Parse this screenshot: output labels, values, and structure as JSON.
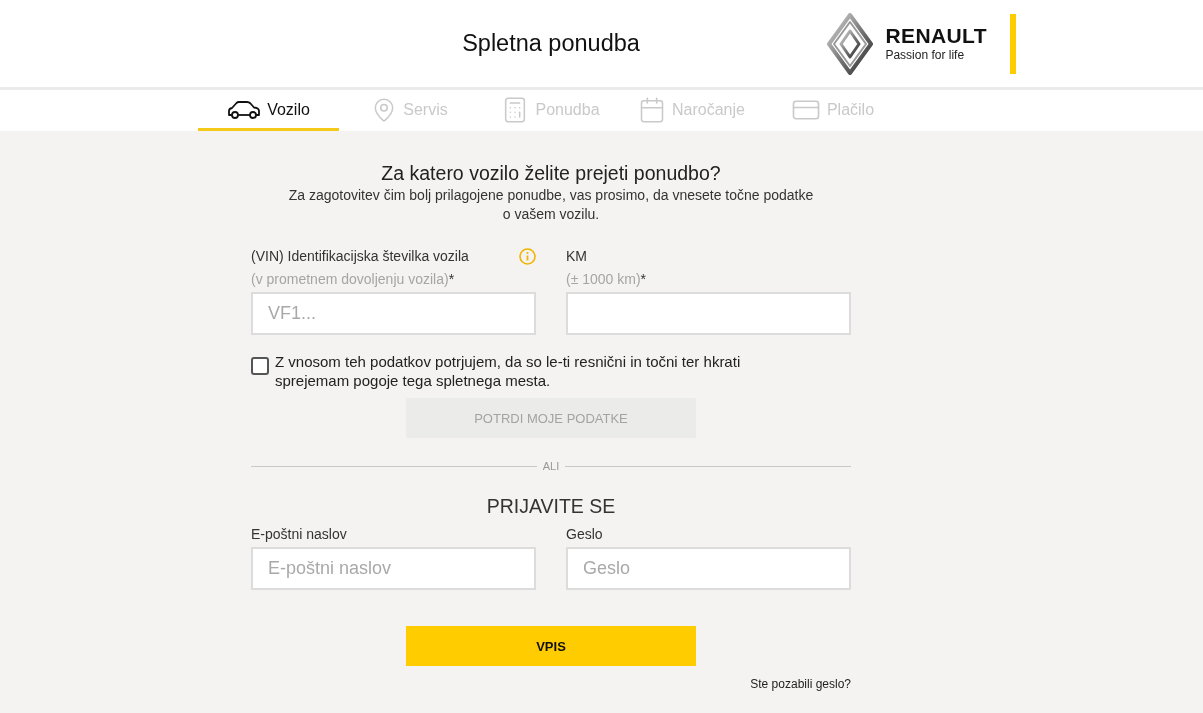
{
  "header": {
    "title": "Spletna ponudba",
    "brand_name": "RENAULT",
    "tagline": "Passion for life"
  },
  "steps": [
    {
      "kind": "car",
      "label": "Vozilo",
      "selected": true
    },
    {
      "kind": "pin",
      "label": "Servis",
      "selected": false
    },
    {
      "kind": "calculator",
      "label": "Ponudba",
      "selected": false
    },
    {
      "kind": "calendar",
      "label": "Naročanje",
      "selected": false
    },
    {
      "kind": "card",
      "label": "Plačilo",
      "selected": false
    }
  ],
  "vehicle_form": {
    "heading": "Za katero vozilo želite prejeti ponudbo?",
    "intro": "Za zagotovitev čim bolj prilagojene ponudbe, vas prosimo, da vnesete točne podatke o vašem vozilu.",
    "fields": [
      {
        "label": "(VIN) Identifikacijska številka vozila",
        "hint": "(v prometnem dovoljenju vozila)",
        "required_mark": "*",
        "info": true,
        "placeholder": "VF1..."
      },
      {
        "label": "KM",
        "hint": "(± 1000 km)",
        "required_mark": "*",
        "info": false
      }
    ],
    "consent": {
      "text": "Z vnosom teh podatkov potrjujem, da so le-ti resnični in točni ter hkrati sprejemam pogoje tega spletnega mesta.",
      "checked": false
    },
    "submit": {
      "label": "POTRDI MOJE PODATKE",
      "disabled": true
    }
  },
  "divider": "ALI",
  "login": {
    "heading": "PRIJAVITE SE",
    "fields": [
      {
        "label": "E-poštni naslov",
        "placeholder": "E-poštni naslov"
      },
      {
        "label": "Geslo",
        "placeholder": "Geslo"
      }
    ],
    "submit": {
      "label": "VPIS",
      "disabled": false
    },
    "forgot_link": "Ste pozabili geslo?"
  }
}
